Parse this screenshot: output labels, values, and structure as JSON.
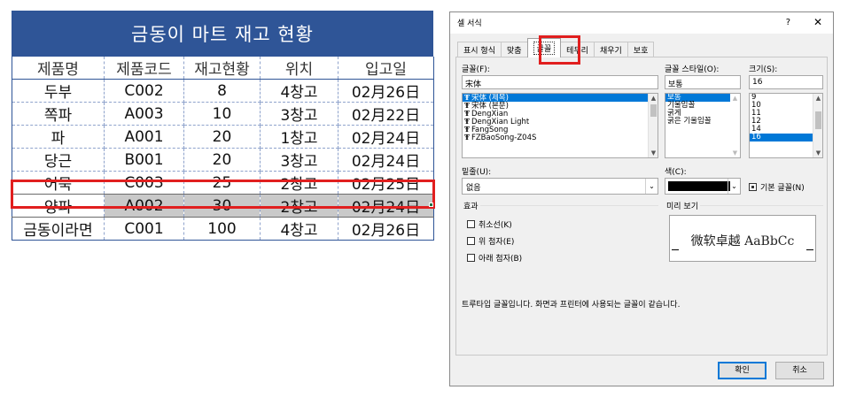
{
  "sheet": {
    "title": "금동이 마트 재고 현황",
    "headers": [
      "제품명",
      "제품코드",
      "재고현황",
      "위치",
      "입고일"
    ],
    "rows": [
      [
        "두부",
        "C002",
        "8",
        "4창고",
        "02月26日"
      ],
      [
        "쪽파",
        "A003",
        "10",
        "3창고",
        "02月22日"
      ],
      [
        "파",
        "A001",
        "20",
        "1창고",
        "02月24日"
      ],
      [
        "당근",
        "B001",
        "20",
        "3창고",
        "02月24日"
      ],
      [
        "어묵",
        "C003",
        "25",
        "2창고",
        "02月25日"
      ],
      [
        "양파",
        "A002",
        "30",
        "2창고",
        "02月24日"
      ],
      [
        "금동이라면",
        "C001",
        "100",
        "4창고",
        "02月26日"
      ]
    ],
    "selected_row_index": 5
  },
  "dialog": {
    "title": "셀 서식",
    "help": "?",
    "close": "✕",
    "tabs": [
      "표시 형식",
      "맞춤",
      "글꼴",
      "테두리",
      "채우기",
      "보호"
    ],
    "active_tab": "글꼴",
    "font_label": "글꼴(F):",
    "font_value": "宋体",
    "font_list": [
      "宋体 (제목)",
      "宋体 (본문)",
      "DengXian",
      "DengXian Light",
      "FangSong",
      "FZBaoSong-Z04S"
    ],
    "style_label": "글꼴 스타일(O):",
    "style_value": "보통",
    "style_list": [
      "보통",
      "기울임꼴",
      "굵게",
      "굵은 기울임꼴"
    ],
    "size_label": "크기(S):",
    "size_value": "16",
    "size_list": [
      "9",
      "10",
      "11",
      "12",
      "14",
      "16"
    ],
    "underline_label": "밑줄(U):",
    "underline_value": "없음",
    "color_label": "색(C):",
    "normal_font_label": "기본 글꼴(N)",
    "effects_label": "효과",
    "effects": [
      "취소선(K)",
      "위 첨자(E)",
      "아래 첨자(B)"
    ],
    "preview_label": "미리 보기",
    "preview_text": "微软卓越  AaBbCc",
    "info_text": "트루타입 글꼴입니다. 화면과 프린터에 사용되는 글꼴이 같습니다.",
    "ok_label": "확인",
    "cancel_label": "취소"
  },
  "colors": {
    "title_bar": "#2f5597",
    "highlight": "#e11f1f",
    "selection": "#0078d7"
  }
}
